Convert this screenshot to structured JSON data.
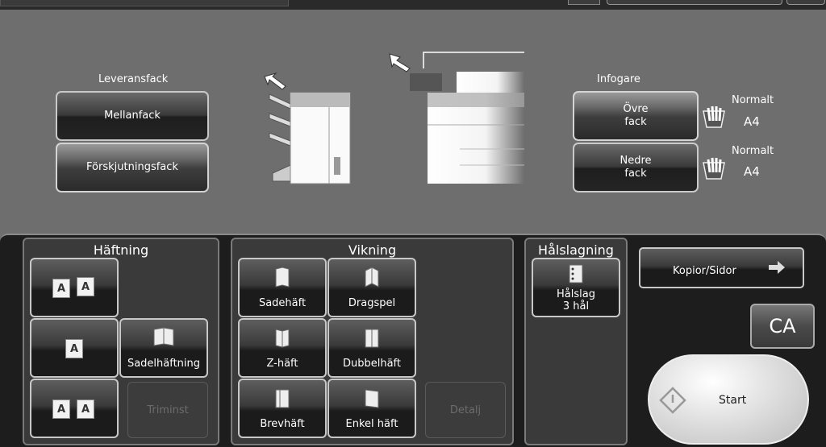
{
  "top_bar": {},
  "delivery": {
    "section_label": "Leveransfack",
    "buttons": [
      "Mellanfack",
      "Förskjutningsfack"
    ]
  },
  "inserter": {
    "section_label": "Infogare",
    "trays": [
      {
        "label": "Övre\nfack",
        "paper_type": "Normalt",
        "paper_size": "A4"
      },
      {
        "label": "Nedre\nfack",
        "paper_type": "Normalt",
        "paper_size": "A4"
      }
    ]
  },
  "stapling": {
    "title": "Häftning",
    "saddle_label": "Sadelhäftning",
    "trim_label": "Triminst"
  },
  "folding": {
    "title": "Vikning",
    "buttons": [
      "Sadehäft",
      "Dragspel",
      "Z-häft",
      "Dubbelhäft",
      "Brevhäft",
      "Enkel häft"
    ],
    "detail_label": "Detalj"
  },
  "punching": {
    "title": "Hålslagning",
    "button_label": "Hålslag\n3 hål"
  },
  "side": {
    "copies_label": "Kopior/Sidor",
    "ca_label": "CA",
    "start_label": "Start"
  },
  "colors": {
    "background": "#6e6e6e",
    "panel": "#1d1d1d",
    "group": "#3a3a3a"
  }
}
